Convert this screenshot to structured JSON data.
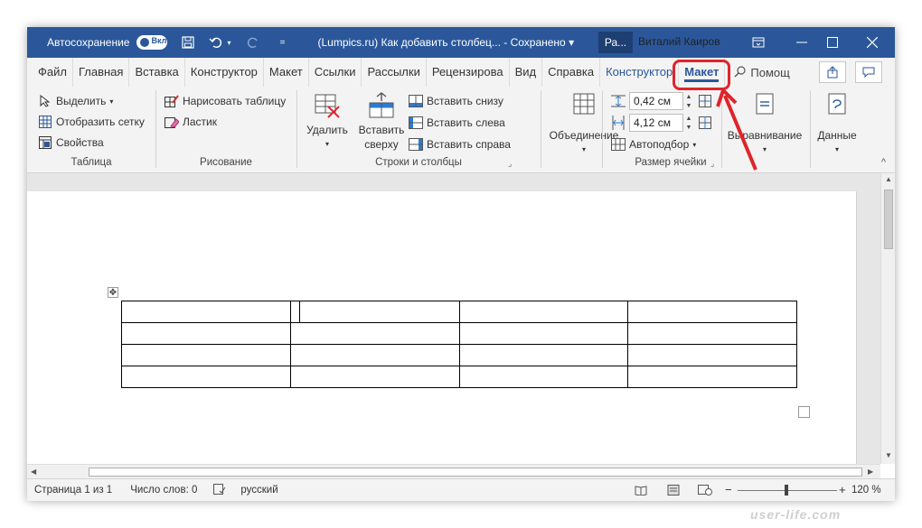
{
  "titlebar": {
    "autosave_label": "Автосохранение",
    "autosave_state": "Вкл",
    "doc_title": "(Lumpics.ru) Как добавить столбец...  -  Сохранено ▾",
    "search_short": "Ра...",
    "user_name": "Виталий Каиров",
    "bg_color": "#2b579a"
  },
  "tabs": [
    {
      "label": "Файл"
    },
    {
      "label": "Главная"
    },
    {
      "label": "Вставка"
    },
    {
      "label": "Конструктор"
    },
    {
      "label": "Макет"
    },
    {
      "label": "Ссылки"
    },
    {
      "label": "Рассылки"
    },
    {
      "label": "Рецензирова"
    },
    {
      "label": "Вид"
    },
    {
      "label": "Справка"
    },
    {
      "label": "Конструктор"
    },
    {
      "label": "Макет"
    }
  ],
  "tab_help": "Помощ",
  "ribbon": {
    "table_group": {
      "select": "Выделить",
      "gridlines": "Отобразить сетку",
      "properties": "Свойства",
      "label": "Таблица"
    },
    "draw_group": {
      "draw_table": "Нарисовать таблицу",
      "eraser": "Ластик",
      "label": "Рисование"
    },
    "rows_cols_group": {
      "delete": "Удалить",
      "insert_above_1": "Вставить",
      "insert_above_2": "сверху",
      "insert_below": "Вставить снизу",
      "insert_left": "Вставить слева",
      "insert_right": "Вставить справа",
      "label": "Строки и столбцы"
    },
    "merge_group": {
      "merge": "Объединение"
    },
    "cell_size_group": {
      "height": "0,42 см",
      "width": "4,12 см",
      "autofit": "Автоподбор",
      "label": "Размер ячейки"
    },
    "alignment": "Выравнивание",
    "data": "Данные"
  },
  "statusbar": {
    "page": "Страница 1 из 1",
    "words": "Число слов: 0",
    "language": "русский",
    "zoom": "120 %"
  },
  "watermark": "user-life.com",
  "accent": "#2b579a",
  "annotation_color": "#e0242b"
}
